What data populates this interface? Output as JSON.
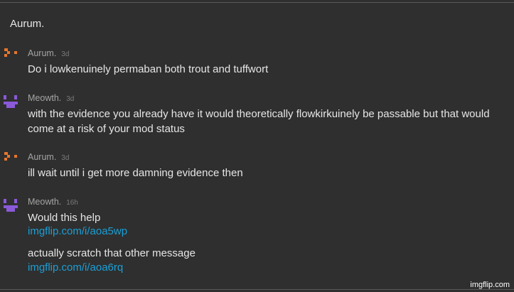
{
  "thread_title": "Aurum.",
  "colors": {
    "aurum": "#e8762b",
    "meowth": "#8a5ad8",
    "link": "#1a9fd6"
  },
  "messages": [
    {
      "user": "Aurum.",
      "time": "3d",
      "avatar_icon": "pixel-face-orange-icon",
      "lines": [
        "Do i lowkenuinely permaban both trout and tuffwort"
      ]
    },
    {
      "user": "Meowth.",
      "time": "3d",
      "avatar_icon": "pixel-cat-purple-icon",
      "lines": [
        "with the evidence you already have it would theoretically flowkirkuinely be passable but that would",
        "come at a risk of your mod status"
      ]
    },
    {
      "user": "Aurum.",
      "time": "3d",
      "avatar_icon": "pixel-face-orange-icon",
      "lines": [
        "ill wait until i get more damning evidence then"
      ]
    },
    {
      "user": "Meowth.",
      "time": "16h",
      "avatar_icon": "pixel-cat-purple-icon",
      "lines": [
        "Would this help",
        "imgflip.com/i/aoa5wp",
        "actually scratch that other message",
        "imgflip.com/i/aoa6rq"
      ]
    }
  ],
  "watermark": "imgflip.com"
}
